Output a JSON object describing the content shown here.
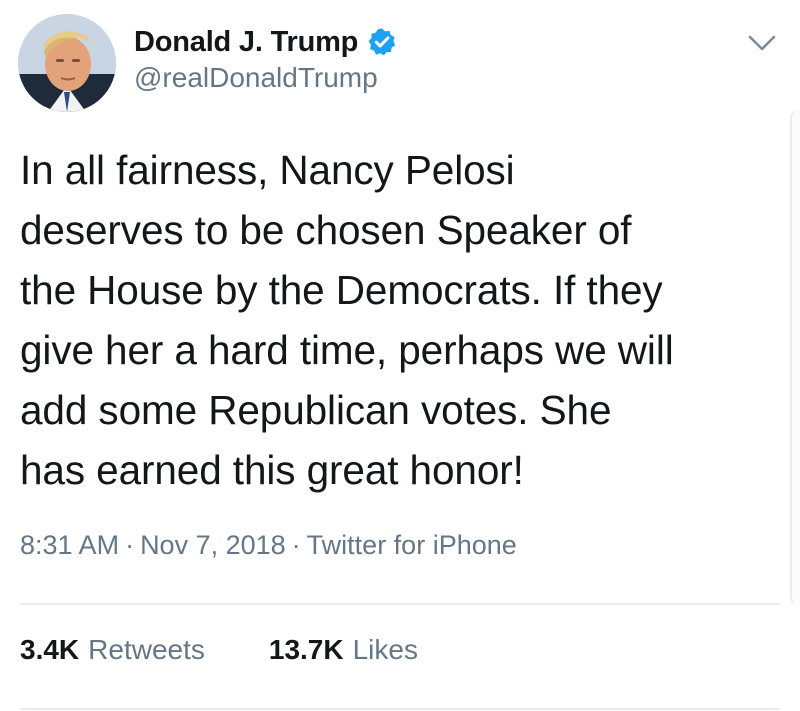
{
  "author": {
    "name": "Donald J. Trump",
    "handle": "@realDonaldTrump",
    "verified": true,
    "avatar_icon": "profile-photo",
    "verified_icon": "verified-badge-icon"
  },
  "header": {
    "menu_icon": "chevron-down-icon"
  },
  "tweet": {
    "lines": [
      "In all fairness, Nancy Pelosi",
      "deserves to be chosen Speaker of",
      "the House by the Democrats. If they",
      "give her a hard time, perhaps we will",
      "add some Republican votes. She",
      "has earned this great honor!"
    ],
    "time": "8:31 AM",
    "date": "Nov 7, 2018",
    "source": "Twitter for iPhone",
    "separator": "·"
  },
  "stats": {
    "retweets_count": "3.4K",
    "retweets_label": "Retweets",
    "likes_count": "13.7K",
    "likes_label": "Likes"
  },
  "colors": {
    "text": "#14171a",
    "secondary": "#657786",
    "verified": "#1da1f2",
    "divider": "#e6ecf0"
  }
}
